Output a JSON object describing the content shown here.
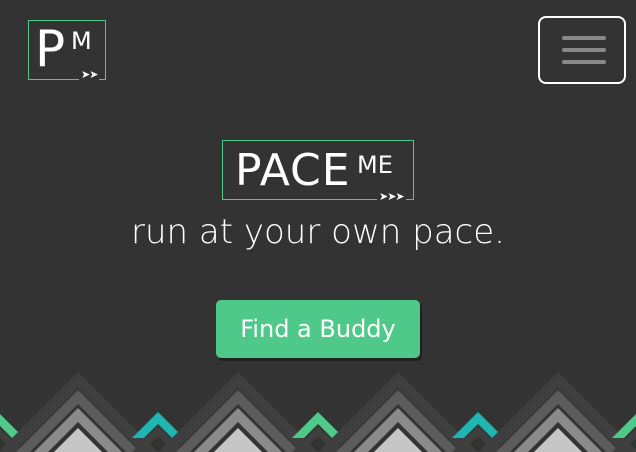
{
  "header": {
    "logo": {
      "letter_p": "P",
      "letter_m": "M",
      "arrows": "➤➤"
    },
    "menu_button_label": "Menu"
  },
  "hero": {
    "logo": {
      "main": "PACE",
      "sup": "ME",
      "arrows": "➤➤➤"
    },
    "tagline": "run at your own pace.",
    "cta_label": "Find a Buddy"
  },
  "colors": {
    "background": "#333333",
    "accent_green": "#4fc98a",
    "accent_teal": "#1fb5b0",
    "pattern_dark": "#3f3f3f",
    "pattern_mid": "#5c5c5c",
    "pattern_light": "#8a8a8a",
    "pattern_lightest": "#c6c6c6"
  },
  "icons": {
    "menu": "hamburger-icon",
    "pattern": "chevron-mountain-pattern"
  }
}
